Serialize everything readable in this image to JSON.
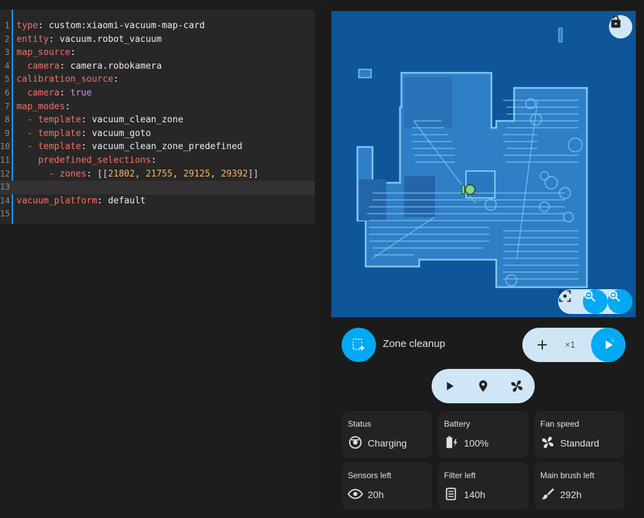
{
  "editor": {
    "lines": [
      {
        "n": "1",
        "key": "type",
        "sep": ": ",
        "val": "custom:xiaomi-vacuum-map-card"
      },
      {
        "n": "2",
        "key": "entity",
        "sep": ": ",
        "val": "vacuum.robot_vacuum"
      },
      {
        "n": "3",
        "key": "map_source",
        "sep": ":",
        "val": ""
      },
      {
        "n": "4",
        "indent": "  ",
        "key": "camera",
        "sep": ": ",
        "val": "camera.robokamera"
      },
      {
        "n": "5",
        "key": "calibration_source",
        "sep": ":",
        "val": ""
      },
      {
        "n": "6",
        "indent": "  ",
        "key": "camera",
        "sep": ": ",
        "bool": "true"
      },
      {
        "n": "7",
        "key": "map_modes",
        "sep": ":",
        "val": ""
      },
      {
        "n": "8",
        "indent": "  - ",
        "key": "template",
        "sep": ": ",
        "val": "vacuum_clean_zone"
      },
      {
        "n": "9",
        "indent": "  - ",
        "key": "template",
        "sep": ": ",
        "val": "vacuum_goto"
      },
      {
        "n": "10",
        "indent": "  - ",
        "key": "template",
        "sep": ": ",
        "val": "vacuum_clean_zone_predefined"
      },
      {
        "n": "11",
        "indent": "    ",
        "key": "predefined_selections",
        "sep": ":",
        "val": ""
      },
      {
        "n": "12",
        "indent": "      - ",
        "key": "zones",
        "sep": ": ",
        "zones": [
          "21802",
          "21755",
          "29125",
          "29392"
        ]
      },
      {
        "n": "13",
        "key": "",
        "sep": "",
        "val": ""
      },
      {
        "n": "14",
        "key": "vacuum_platform",
        "sep": ": ",
        "val": "default"
      },
      {
        "n": "15",
        "key": "",
        "sep": "",
        "val": ""
      }
    ]
  },
  "card": {
    "map": {
      "lock_icon": "lock-open-icon",
      "zoom_icons": [
        "focus-icon",
        "zoom-out-icon",
        "zoom-in-icon"
      ]
    },
    "mode": {
      "icon": "select-drag-icon",
      "label": "Zone cleanup"
    },
    "run": {
      "add_icon": "plus-icon",
      "repeat": "×1",
      "start_icon": "play-icon"
    },
    "controls": [
      "play-icon",
      "map-marker-icon",
      "fan-icon"
    ],
    "tiles": [
      {
        "title": "Status",
        "icon": "robot-vacuum-icon",
        "value": "Charging"
      },
      {
        "title": "Battery",
        "icon": "battery-charging-icon",
        "value": "100%"
      },
      {
        "title": "Fan speed",
        "icon": "fan-icon",
        "value": "Standard"
      },
      {
        "title": "Sensors left",
        "icon": "eye-icon",
        "value": "20h"
      },
      {
        "title": "Filter left",
        "icon": "air-filter-icon",
        "value": "140h"
      },
      {
        "title": "Main brush left",
        "icon": "brush-icon",
        "value": "292h"
      }
    ]
  },
  "colors": {
    "accent": "#03a9f4",
    "pill": "#cfe6f7",
    "map_bg": "#0e5599",
    "map_floor": "#2f7fc7",
    "map_wall": "#7fc8f2"
  }
}
